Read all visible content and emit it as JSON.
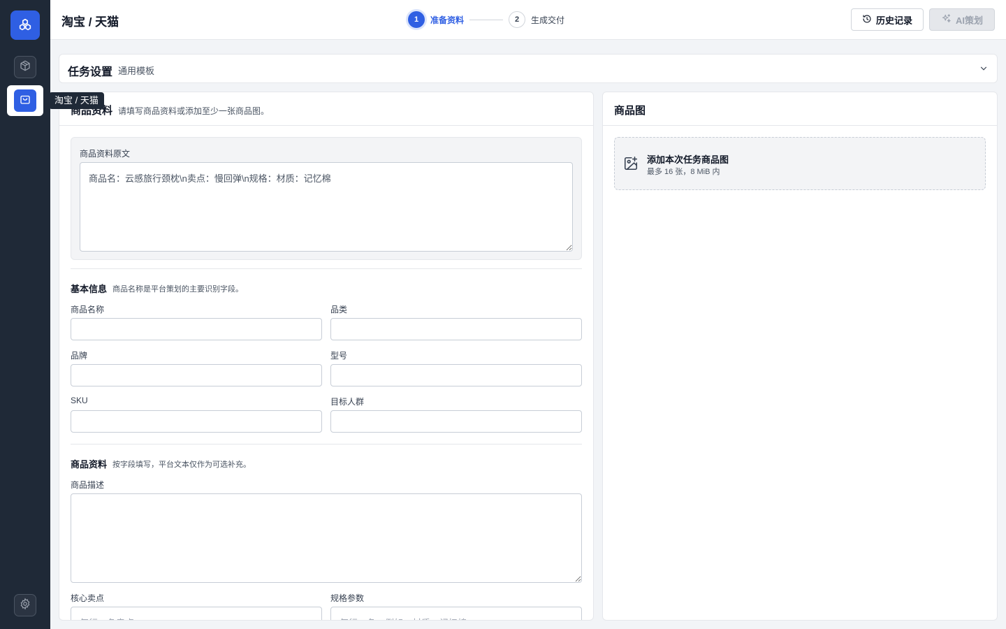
{
  "sidebar": {
    "tooltip": "淘宝 / 天猫"
  },
  "header": {
    "title": "淘宝 / 天猫",
    "steps": [
      {
        "num": "1",
        "label": "准备资料"
      },
      {
        "num": "2",
        "label": "生成交付"
      }
    ],
    "history_label": "历史记录",
    "ai_label": "AI策划"
  },
  "task_settings": {
    "title": "任务设置",
    "template": "通用模板"
  },
  "product": {
    "title": "商品资料",
    "hint": "请填写商品资料或添加至少一张商品图。",
    "raw_label": "商品资料原文",
    "raw_value": "商品名：云感旅行颈枕\\n卖点：慢回弹\\n规格：材质：记忆棉",
    "basic": {
      "title": "基本信息",
      "hint": "商品名称是平台策划的主要识别字段。",
      "name_label": "商品名称",
      "category_label": "品类",
      "brand_label": "品牌",
      "model_label": "型号",
      "sku_label": "SKU",
      "audience_label": "目标人群"
    },
    "detail": {
      "title": "商品资料",
      "hint": "按字段填写，平台文本仅作为可选补充。",
      "desc_label": "商品描述",
      "selling_label": "核心卖点",
      "selling_placeholder": "每行一条卖点",
      "spec_label": "规格参数",
      "spec_placeholder": "每行一条，例如：材质：记忆棉"
    }
  },
  "images": {
    "title": "商品图",
    "add_title": "添加本次任务商品图",
    "add_hint": "最多 16 张，8 MiB 内"
  },
  "colors": {
    "accent": "#2f5fe3",
    "sidebar_bg": "#1f2937"
  }
}
